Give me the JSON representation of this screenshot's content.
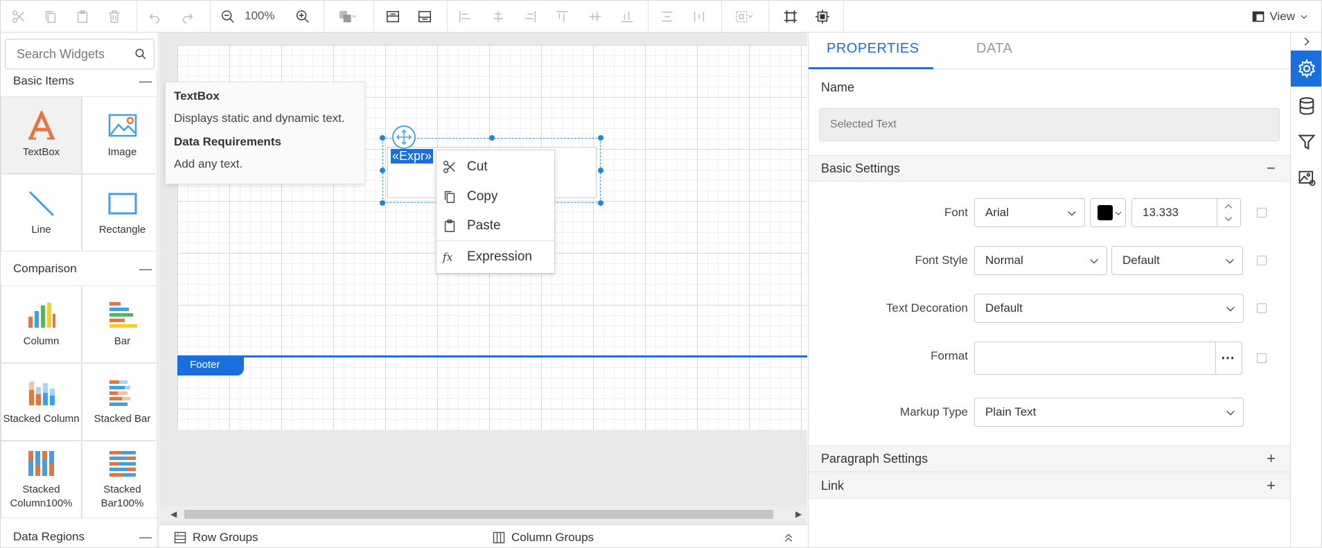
{
  "toolbar": {
    "zoom": "100%",
    "view_label": "View"
  },
  "widgets": {
    "search_placeholder": "Search Widgets",
    "sections": [
      {
        "title": "Basic Items",
        "items": [
          "TextBox",
          "Image",
          "Line",
          "Rectangle"
        ]
      },
      {
        "title": "Comparison",
        "items": [
          "Column",
          "Bar",
          "Stacked Column",
          "Stacked Bar",
          "Stacked Column100%",
          "Stacked Bar100%"
        ]
      },
      {
        "title": "Data Regions"
      }
    ]
  },
  "tooltip": {
    "title": "TextBox",
    "description": "Displays static and dynamic text.",
    "req_title": "Data Requirements",
    "req_text": "Add any text."
  },
  "canvas": {
    "expr_text": "«Expr»",
    "footer_label": "Footer"
  },
  "context_menu": {
    "items": [
      "Cut",
      "Copy",
      "Paste",
      "Expression"
    ]
  },
  "bottom_bar": {
    "row_groups": "Row Groups",
    "column_groups": "Column Groups"
  },
  "properties": {
    "tabs": [
      "PROPERTIES",
      "DATA"
    ],
    "name_label": "Name",
    "name_placeholder": "Selected Text",
    "basic_settings": "Basic Settings",
    "font_label": "Font",
    "font_value": "Arial",
    "font_color": "#000000",
    "font_size": "13.333",
    "font_style_label": "Font Style",
    "font_style_value": "Normal",
    "font_weight_value": "Default",
    "text_decoration_label": "Text Decoration",
    "text_decoration_value": "Default",
    "format_label": "Format",
    "format_value": "",
    "markup_type_label": "Markup Type",
    "markup_type_value": "Plain Text",
    "paragraph_settings": "Paragraph Settings",
    "link": "Link"
  },
  "colors": {
    "accent": "#1a6fe0",
    "textbox_icon": "#e8743b",
    "widget_icon_blue": "#3f9fe8"
  },
  "rail_icons": [
    "settings-icon",
    "database-icon",
    "filter-icon",
    "image-settings-icon"
  ]
}
